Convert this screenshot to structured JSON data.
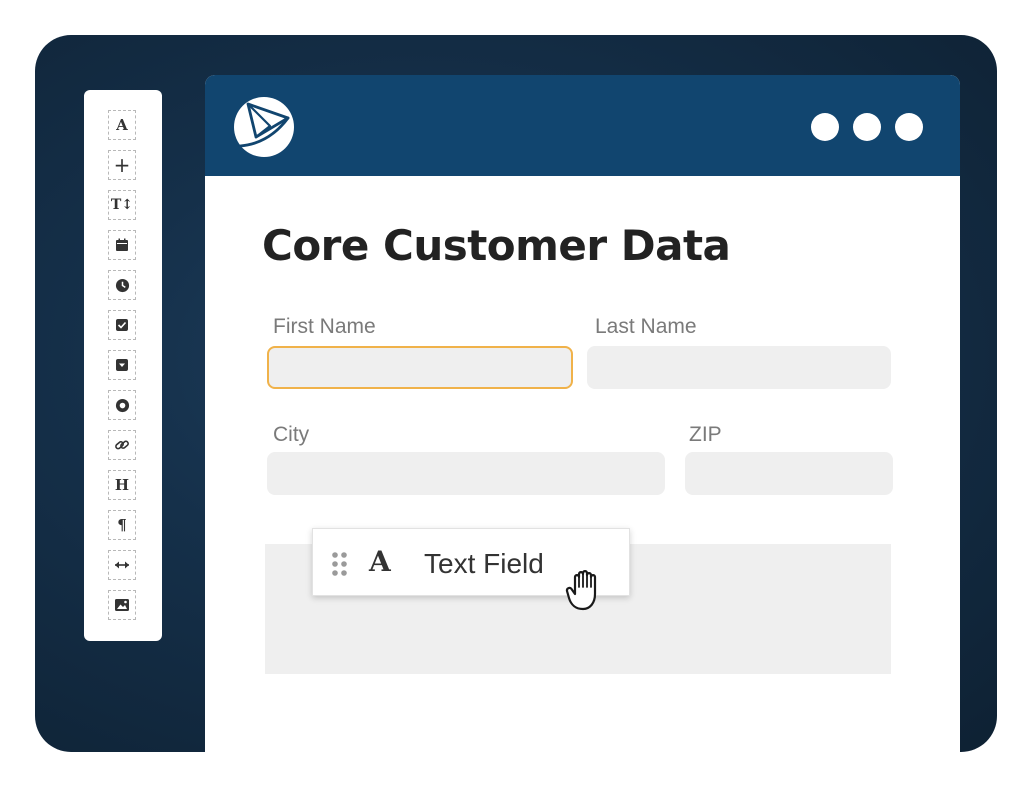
{
  "palette": {
    "tools": [
      {
        "icon": "text-letter-icon",
        "glyph": "A"
      },
      {
        "icon": "plus-icon",
        "glyph": "+"
      },
      {
        "icon": "text-size-icon",
        "glyph": "T↕"
      },
      {
        "icon": "calendar-icon",
        "glyph": ""
      },
      {
        "icon": "clock-icon",
        "glyph": ""
      },
      {
        "icon": "checkbox-icon",
        "glyph": ""
      },
      {
        "icon": "dropdown-icon",
        "glyph": ""
      },
      {
        "icon": "radio-icon",
        "glyph": ""
      },
      {
        "icon": "link-icon",
        "glyph": ""
      },
      {
        "icon": "heading-icon",
        "glyph": "H"
      },
      {
        "icon": "paragraph-icon",
        "glyph": "¶"
      },
      {
        "icon": "horizontal-resize-icon",
        "glyph": ""
      },
      {
        "icon": "image-icon",
        "glyph": ""
      }
    ]
  },
  "window": {
    "logo_icon": "paper-plane-logo-icon",
    "titlebar_color": "#11456f",
    "menu_dots_icon": "window-dots-icon"
  },
  "form": {
    "title": "Core Customer Data",
    "fields": {
      "first_name": {
        "label": "First Name",
        "value": "",
        "active": true
      },
      "last_name": {
        "label": "Last Name",
        "value": ""
      },
      "city": {
        "label": "City",
        "value": ""
      },
      "zip": {
        "label": "ZIP",
        "value": ""
      }
    }
  },
  "drag_item": {
    "label": "Text Field",
    "handle_icon": "drag-handle-icon",
    "type_icon": "text-letter-icon",
    "cursor_icon": "grab-hand-icon"
  },
  "colors": {
    "accent_focus": "#f0b24a",
    "field_bg": "#efefef"
  }
}
